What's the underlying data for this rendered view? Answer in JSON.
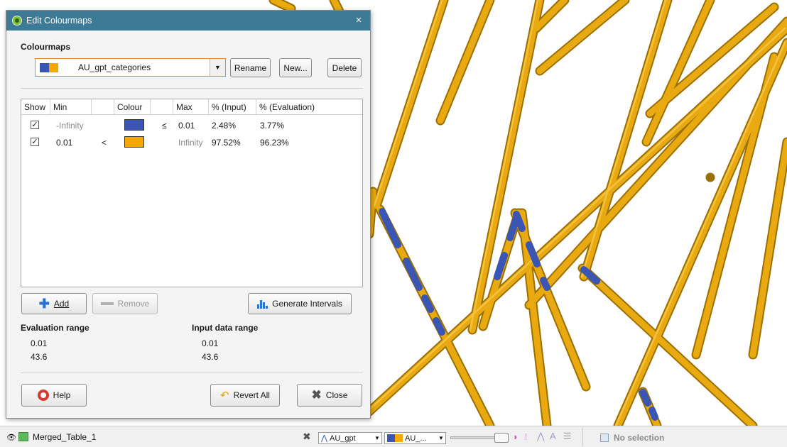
{
  "dialog": {
    "title": "Edit Colourmaps",
    "colourmaps_heading": "Colourmaps",
    "selected_colourmap": "AU_gpt_categories",
    "buttons": {
      "rename": "Rename",
      "new": "New...",
      "delete": "Delete"
    },
    "table": {
      "headers": [
        "Show",
        "Min",
        "",
        "Colour",
        "",
        "Max",
        "% (Input)",
        "% (Evaluation)"
      ],
      "rows": [
        {
          "show": true,
          "min": "-Infinity",
          "min_op": "",
          "colour": "#3a55b4",
          "max_op": "≤",
          "max": "0.01",
          "pct_input": "2.48%",
          "pct_eval": "3.77%"
        },
        {
          "show": true,
          "min": "0.01",
          "min_op": "<",
          "colour": "#f5a800",
          "max_op": "",
          "max": "Infinity",
          "pct_input": "97.52%",
          "pct_eval": "96.23%"
        }
      ]
    },
    "add_label": "Add",
    "remove_label": "Remove",
    "generate_label": "Generate Intervals",
    "evaluation_range": {
      "label": "Evaluation range",
      "min": "0.01",
      "max": "43.6"
    },
    "input_range": {
      "label": "Input data range",
      "min": "0.01",
      "max": "43.6"
    },
    "help_label": "Help",
    "revert_label": "Revert All",
    "close_label": "Close",
    "close_icon": "×"
  },
  "statusbar": {
    "object_name": "Merged_Table_1",
    "attribute_combo": "AU_gpt",
    "colourmap_combo": "AU_...",
    "selection": "No selection"
  },
  "colors": {
    "title_bar": "#3c7a96",
    "low_category": "#3a55b4",
    "high_category": "#f5a800",
    "drillhole": "#e0a400"
  }
}
